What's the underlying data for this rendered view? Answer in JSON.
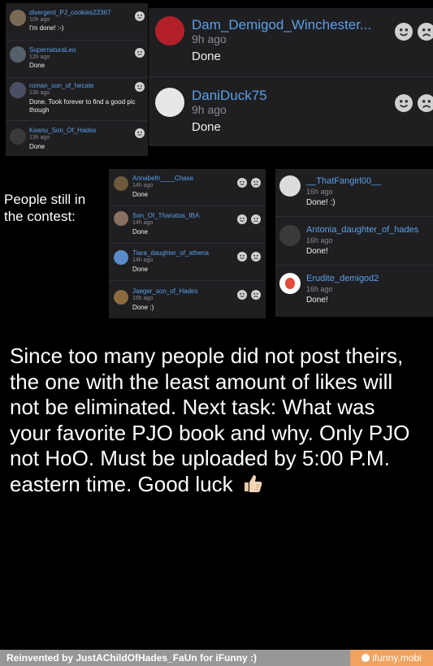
{
  "top_left_comments": [
    {
      "user": "divergent_PJ_cookies22367",
      "time": "10h ago",
      "text": "I'm done! :-)"
    },
    {
      "user": "SupernaturaLeo",
      "time": "12h ago",
      "text": "Done"
    },
    {
      "user": "roman_son_of_hecate",
      "time": "13h ago",
      "text": "Done. Took forever to find a good pic",
      "text2": "though"
    },
    {
      "user": "Keanu_Son_Of_Hades",
      "time": "13h ago",
      "text": "Done"
    }
  ],
  "top_right_comments": [
    {
      "user": "Dam_Demigod_Winchester...",
      "time": "9h ago",
      "text": "Done"
    },
    {
      "user": "DaniDuck75",
      "time": "9h ago",
      "text": "Done"
    }
  ],
  "contest_label": {
    "line1": "People still in",
    "line2": "the contest:"
  },
  "mid_left_comments": [
    {
      "user": "Annabeth____Chase",
      "time": "14h ago",
      "text": "Done"
    },
    {
      "user": "Son_Of_Thanatos_IBA",
      "time": "14h ago",
      "text": "Done"
    },
    {
      "user": "Tiara_daughter_of_athena",
      "time": "14h ago",
      "text": "Done"
    },
    {
      "user": "Jaeger_son_of_Hades",
      "time": "15h ago",
      "text": "Done :)"
    }
  ],
  "mid_right_comments": [
    {
      "user": "__ThatFangirl00__",
      "time": "16h ago",
      "text": "Done! :)"
    },
    {
      "user": "Antonia_daughter_of_hades",
      "time": "16h ago",
      "text": "Done!"
    },
    {
      "user": "Erudite_demigod2",
      "time": "16h ago",
      "text": "Done!"
    }
  ],
  "announcement": "Since too many people did not post theirs, the one with the least amount of likes will not be eliminated. Next task: What was your favorite PJO book and why. Only PJO not HoO. Must be uploaded by 5:00 P.M. eastern time. Good luck",
  "footer": {
    "credit": "Reinvented by JustAChildOfHades_FaUn for iFunny :)",
    "brand": "ifunny.mobi"
  },
  "colors": {
    "username": "#5aa0e8",
    "panel": "#1f1f22",
    "footer_left": "#979797",
    "footer_right": "#f0a35e"
  }
}
